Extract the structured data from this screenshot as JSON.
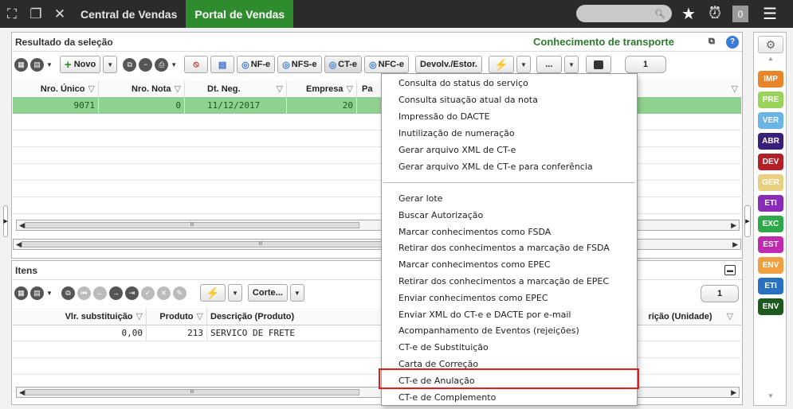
{
  "topbar": {
    "tabs": [
      {
        "label": "Central de Vendas"
      },
      {
        "label": "Portal de Vendas"
      }
    ],
    "badge": "0"
  },
  "result_panel": {
    "title": "Resultado da seleção",
    "subtitle": "Conhecimento de transporte",
    "toolbar": {
      "novo": "Novo",
      "nfe": "NF-e",
      "nfse": "NFS-e",
      "cte": "CT-e",
      "nfce": "NFC-e",
      "devolv": "Devolv./Estor.",
      "more": "...",
      "page": "1"
    },
    "columns": [
      "Nro. Único",
      "Nro. Nota",
      "Dt. Neg.",
      "Empresa",
      "Pa"
    ],
    "rows": [
      {
        "nro_unico": "9071",
        "nro_nota": "0",
        "dt_neg": "11/12/2017",
        "empresa": "20"
      }
    ]
  },
  "items_panel": {
    "title": "Itens",
    "toolbar": {
      "corte": "Corte...",
      "page": "1"
    },
    "columns": [
      "Vlr. substituição",
      "Produto",
      "Descrição (Produto)",
      "rição (Unidade)"
    ],
    "rows": [
      {
        "vlr": "0,00",
        "produto": "213",
        "descricao": "SERVICO DE FRETE"
      }
    ]
  },
  "context_menu": {
    "group1": [
      "Consulta do status do serviço",
      "Consulta situação atual da nota",
      "Impressão do DACTE",
      "Inutilização de numeração",
      "Gerar arquivo XML de CT-e",
      "Gerar arquivo XML de CT-e para conferência"
    ],
    "group2": [
      "Gerar lote",
      "Buscar Autorização",
      "Marcar conhecimentos como FSDA",
      "Retirar dos conhecimentos a marcação de FSDA",
      "Marcar conhecimentos como EPEC",
      "Retirar dos conhecimentos a marcação de EPEC",
      "Enviar conhecimentos como EPEC",
      "Enviar XML do CT-e e DACTE por e-mail",
      "Acompanhamento de Eventos (rejeições)",
      "CT-e de Substituição",
      "Carta de Correção",
      "CT-e de Anulação",
      "CT-e de Complemento"
    ],
    "highlighted": "CT-e de Anulação"
  },
  "sidebar": {
    "buttons": [
      {
        "label": "IMP",
        "color": "#e8842a"
      },
      {
        "label": "PRE",
        "color": "#9ad35a"
      },
      {
        "label": "VER",
        "color": "#6ab4e8"
      },
      {
        "label": "ABR",
        "color": "#3a1f7a"
      },
      {
        "label": "DEV",
        "color": "#b2202a"
      },
      {
        "label": "GER",
        "color": "#e8d080"
      },
      {
        "label": "ETI",
        "color": "#8a2ab8"
      },
      {
        "label": "EXC",
        "color": "#2fa84a"
      },
      {
        "label": "EST",
        "color": "#c02ab0"
      },
      {
        "label": "ENV",
        "color": "#f0a040"
      },
      {
        "label": "ETI",
        "color": "#2a70c0"
      },
      {
        "label": "ENV",
        "color": "#1e5a1e"
      }
    ]
  },
  "colors": {
    "accent": "#2e8b2e",
    "selected_row": "#8fd18f",
    "highlight_border": "#e01c1c"
  }
}
